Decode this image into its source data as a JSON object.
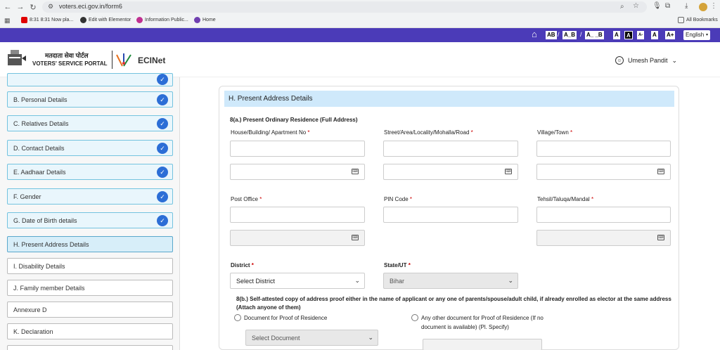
{
  "browser": {
    "url": "voters.eci.gov.in/form6",
    "bookmarks": [
      {
        "label": "8:31 8:31 Now pla...",
        "color": "#e00000"
      },
      {
        "label": "Edit with Elementor",
        "color": "#333333"
      },
      {
        "label": "Information Public...",
        "color": "#c03090"
      },
      {
        "label": "Home",
        "color": "#7040b0"
      }
    ],
    "all_bookmarks": "All Bookmarks"
  },
  "topbar": {
    "font_buttons": [
      "AB",
      "A_B",
      "A_ _B",
      "A",
      "A",
      "A-",
      "A",
      "A+"
    ],
    "separator": "/",
    "language": "English"
  },
  "header": {
    "logo_hindi": "मतदाता सेवा पोर्टल",
    "logo_english": "VOTERS' SERVICE PORTAL",
    "ecinet": "ECINet",
    "user_name": "Umesh Pandit"
  },
  "sidebar": {
    "items": [
      {
        "label": "",
        "state": "done"
      },
      {
        "label": "B. Personal Details",
        "state": "done"
      },
      {
        "label": "C. Relatives Details",
        "state": "done"
      },
      {
        "label": "D. Contact Details",
        "state": "done"
      },
      {
        "label": "E. Aadhaar Details",
        "state": "done"
      },
      {
        "label": "F. Gender",
        "state": "done"
      },
      {
        "label": "G. Date of Birth details",
        "state": "done"
      },
      {
        "label": "H. Present Address Details",
        "state": "active"
      },
      {
        "label": "I. Disability Details",
        "state": "todo"
      },
      {
        "label": "J. Family member Details",
        "state": "todo"
      },
      {
        "label": "Annexure D",
        "state": "todo"
      },
      {
        "label": "K. Declaration",
        "state": "todo"
      }
    ]
  },
  "form": {
    "section_title": "H. Present Address Details",
    "sub_a": "8(a.) Present Ordinary Residence (Full Address)",
    "req": "*",
    "fields": {
      "house": "House/Building/ Apartment No",
      "street": "Street/Area/Locality/Mohalla/Road",
      "village": "Village/Town",
      "post_office": "Post Office",
      "pin": "PIN Code",
      "tehsil": "Tehsil/Taluqa/Mandal",
      "district": "District",
      "state": "State/UT"
    },
    "district_value": "Select District",
    "state_value": "Bihar",
    "sub_b": "8(b.) Self-attested copy of address proof either in the name of applicant or any one of parents/spouse/adult child, if already enrolled as elector at the same address",
    "sub_b_note": "(Attach anyone of them)",
    "radio_1": "Document for Proof of Residence",
    "radio_2_line1": "Any other document for Proof of Residence (If no",
    "radio_2_line2": "document is available) (Pl. Specify)",
    "document_value": "Select Document"
  }
}
